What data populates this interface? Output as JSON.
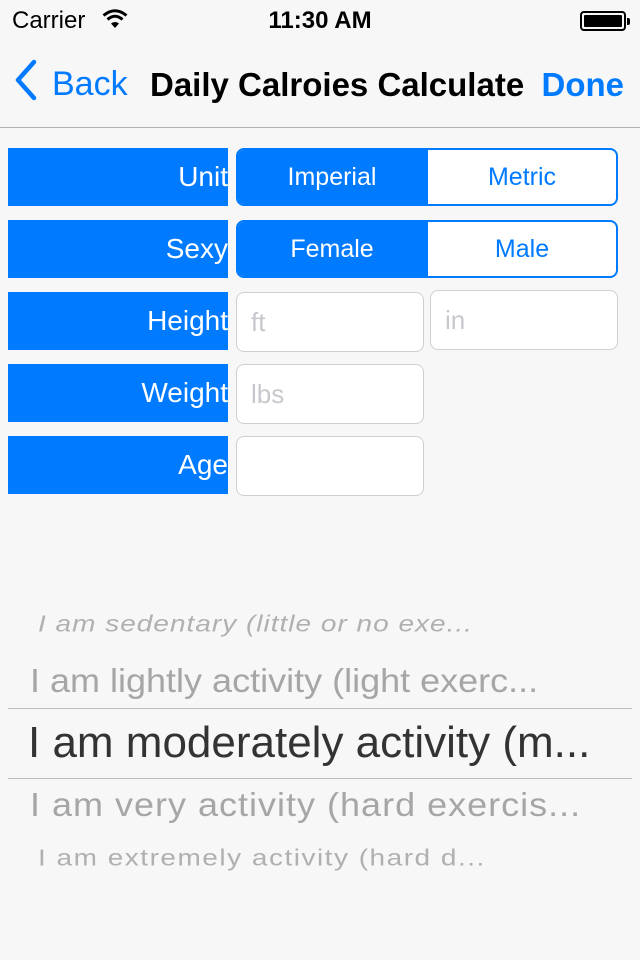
{
  "status_bar": {
    "carrier": "Carrier",
    "time": "11:30 AM",
    "wifi_icon": "wifi-icon",
    "battery_icon": "battery-icon"
  },
  "nav": {
    "back_label": "Back",
    "title": "Daily Calroies Calculate",
    "done_label": "Done",
    "accent_color": "#007aff"
  },
  "form": {
    "unit": {
      "label": "Unit",
      "options": [
        "Imperial",
        "Metric"
      ],
      "selected": "Imperial"
    },
    "sex": {
      "label": "Sexy",
      "options": [
        "Female",
        "Male"
      ],
      "selected": "Female"
    },
    "height": {
      "label": "Height",
      "ft_placeholder": "ft",
      "in_placeholder": "in",
      "ft_value": "",
      "in_value": ""
    },
    "weight": {
      "label": "Weight",
      "placeholder": "lbs",
      "value": ""
    },
    "age": {
      "label": "Age",
      "placeholder": "",
      "value": ""
    }
  },
  "activity_picker": {
    "items": [
      "I am sedentary (little or no exe...",
      "I am lightly activity (light exerc...",
      "I am moderately activity (m...",
      "I am very activity (hard exercis...",
      "I am extremely activity (hard d..."
    ],
    "selected_index": 2
  }
}
